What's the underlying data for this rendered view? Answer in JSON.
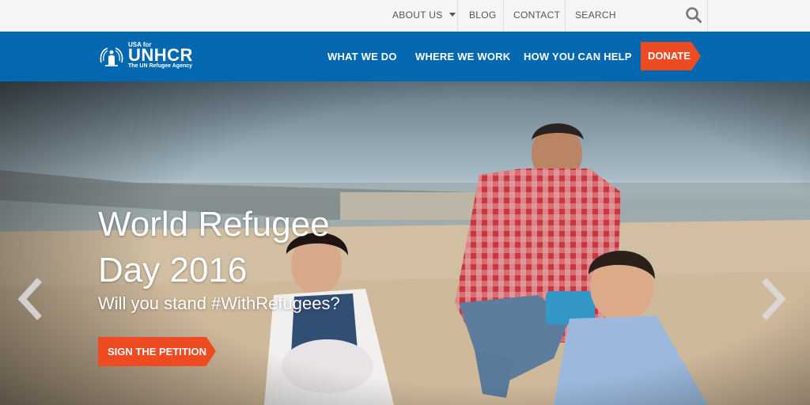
{
  "utility_nav": {
    "items": [
      {
        "label": "ABOUT US",
        "has_dropdown": true
      },
      {
        "label": "BLOG"
      },
      {
        "label": "CONTACT"
      }
    ],
    "search_placeholder": "SEARCH"
  },
  "brand": {
    "prefix": "USA for",
    "name": "UNHCR",
    "tagline": "The UN Refugee Agency"
  },
  "main_nav": {
    "items": [
      {
        "label": "WHAT WE DO"
      },
      {
        "label": "WHERE WE WORK"
      },
      {
        "label": "HOW YOU CAN HELP"
      }
    ],
    "donate_label": "DONATE"
  },
  "hero": {
    "title_line1": "World Refugee",
    "title_line2": "Day 2016",
    "subtitle": "Will you stand #WithRefugees?",
    "cta_label": "SIGN THE PETITION"
  },
  "colors": {
    "brand_blue": "#0468b1",
    "accent_orange": "#ef4b23",
    "utility_bg": "#f5f5f5"
  },
  "icons": [
    "search-icon",
    "unhcr-emblem-icon",
    "chevron-left-icon",
    "chevron-right-icon",
    "caret-down-icon"
  ]
}
